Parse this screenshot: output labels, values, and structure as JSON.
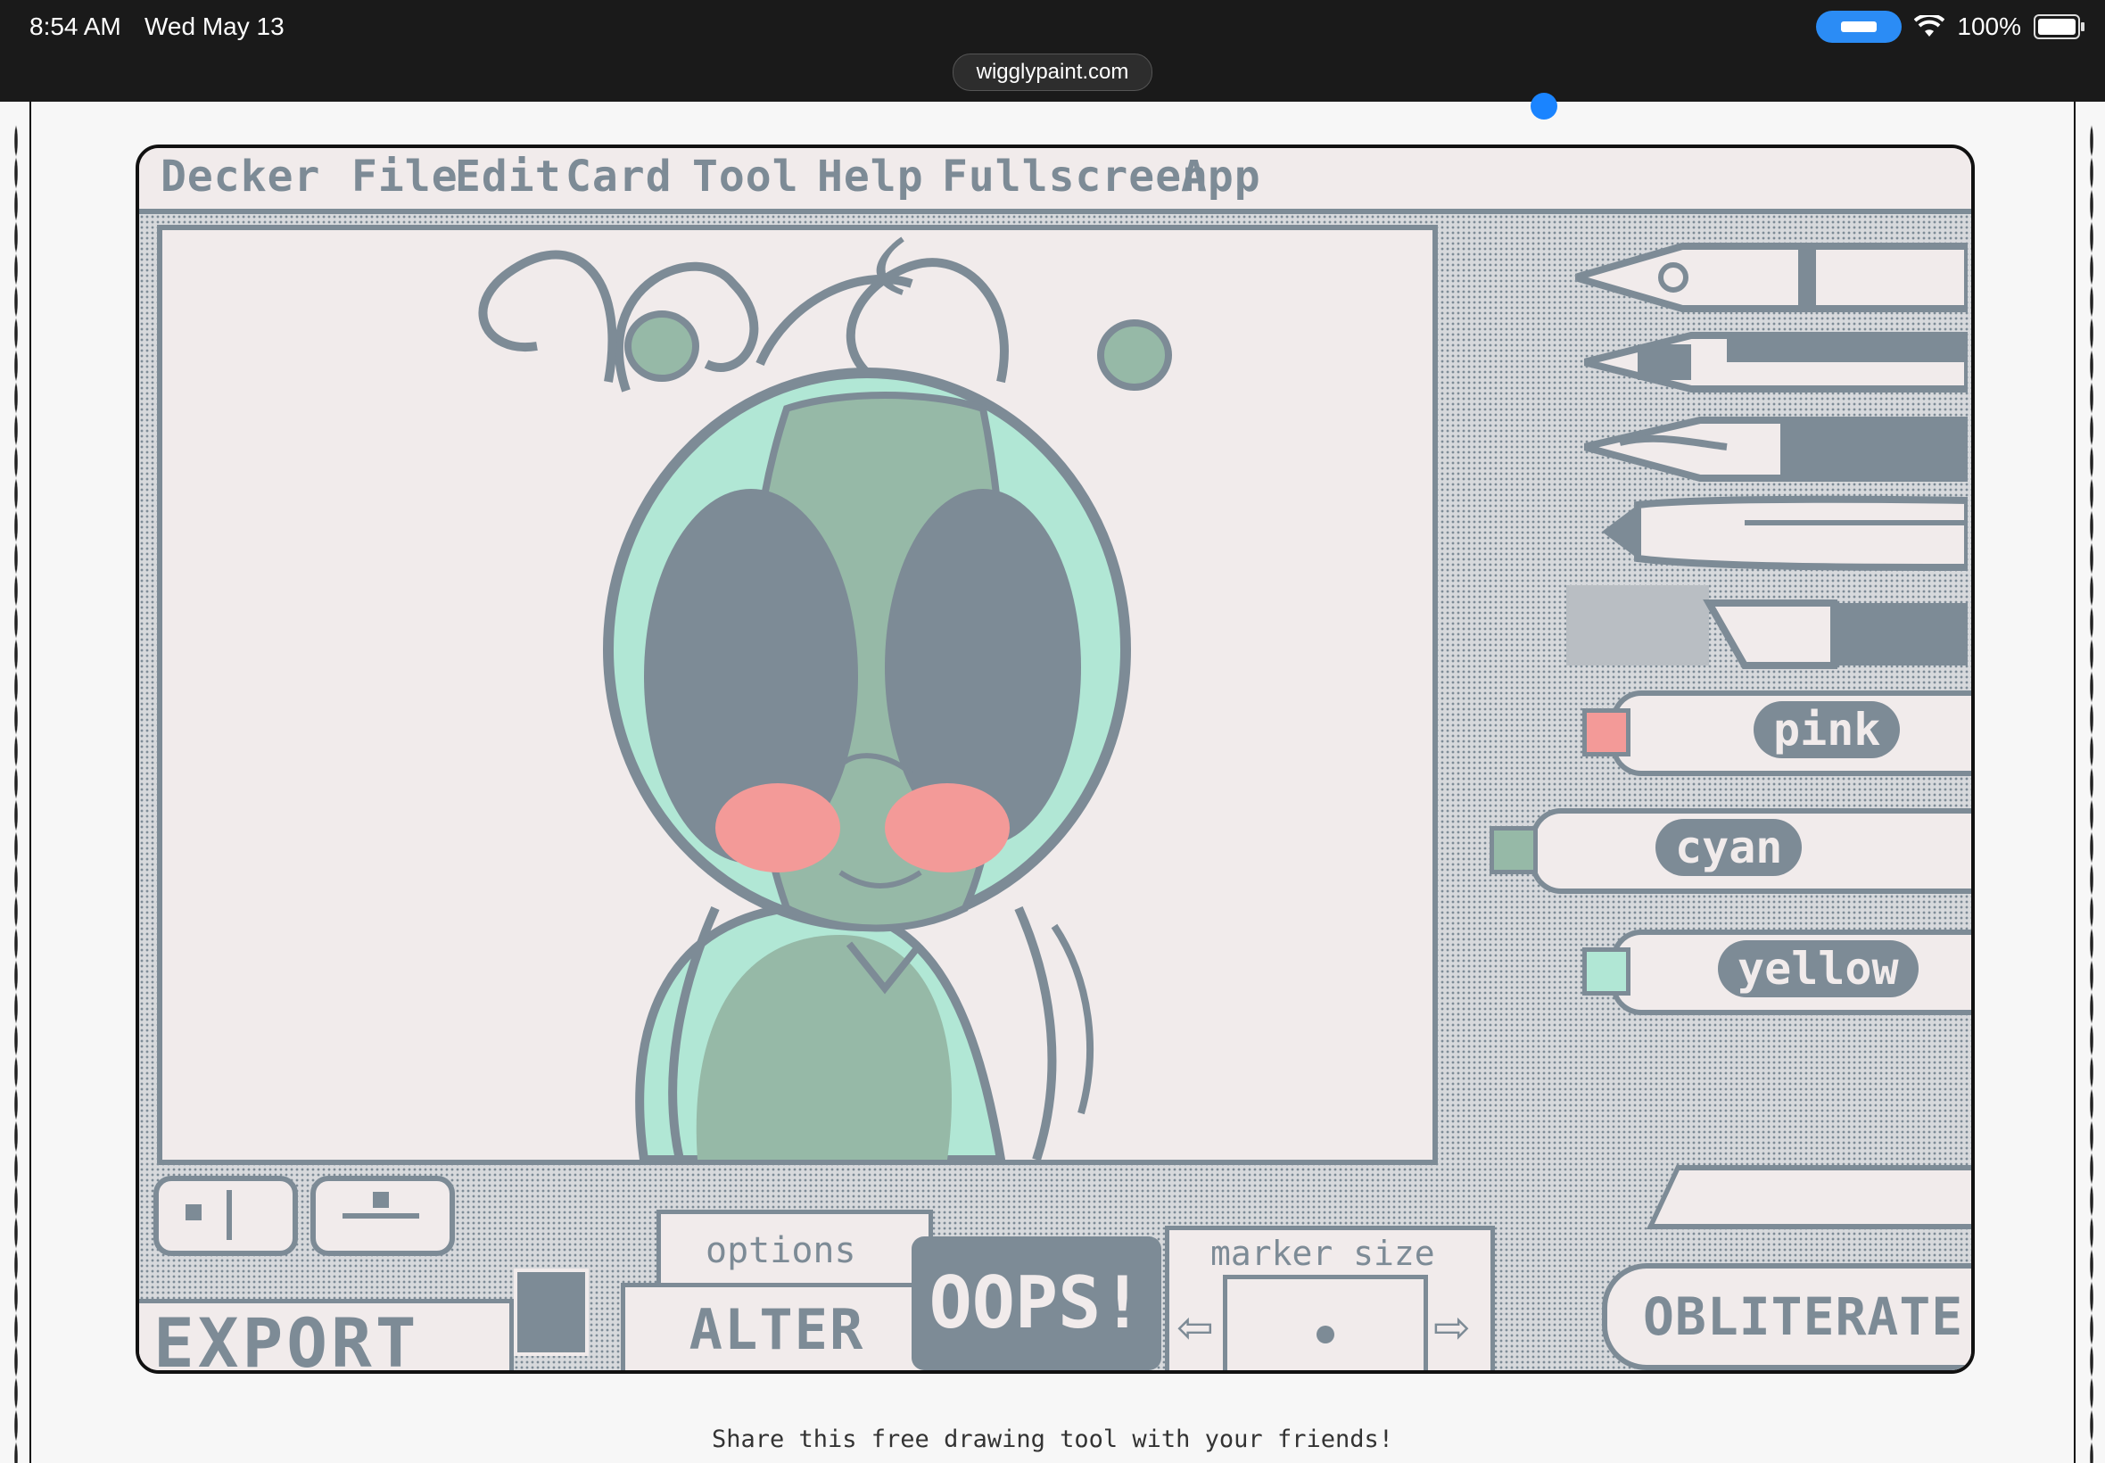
{
  "status_bar": {
    "time": "8:54 AM",
    "date": "Wed May 13",
    "battery": "100%",
    "url": "wigglypaint.com"
  },
  "menu": {
    "items": [
      "Decker",
      "File",
      "Edit",
      "Card",
      "Tool",
      "Help",
      "Fullscreen",
      "App"
    ]
  },
  "tools": {
    "markers": [
      {
        "label": "pink",
        "color": "#f39a98"
      },
      {
        "label": "cyan",
        "color": "#96b9a7"
      },
      {
        "label": "yellow",
        "color": "#b1e7d5"
      }
    ]
  },
  "controls": {
    "options_label": "options",
    "alter_label": "ALTER",
    "oops_label": "OOPS!",
    "marker_size_label": "marker size",
    "export_label": "EXPORT",
    "obliterate_label": "OBLITERATE!"
  },
  "footer": {
    "share_text": "Share this free drawing tool with your friends!"
  },
  "colors": {
    "ink": "#7d8b96",
    "paper": "#f1ebeb",
    "mint": "#b1e7d5",
    "sage": "#96b9a7",
    "pink": "#f39a98"
  }
}
